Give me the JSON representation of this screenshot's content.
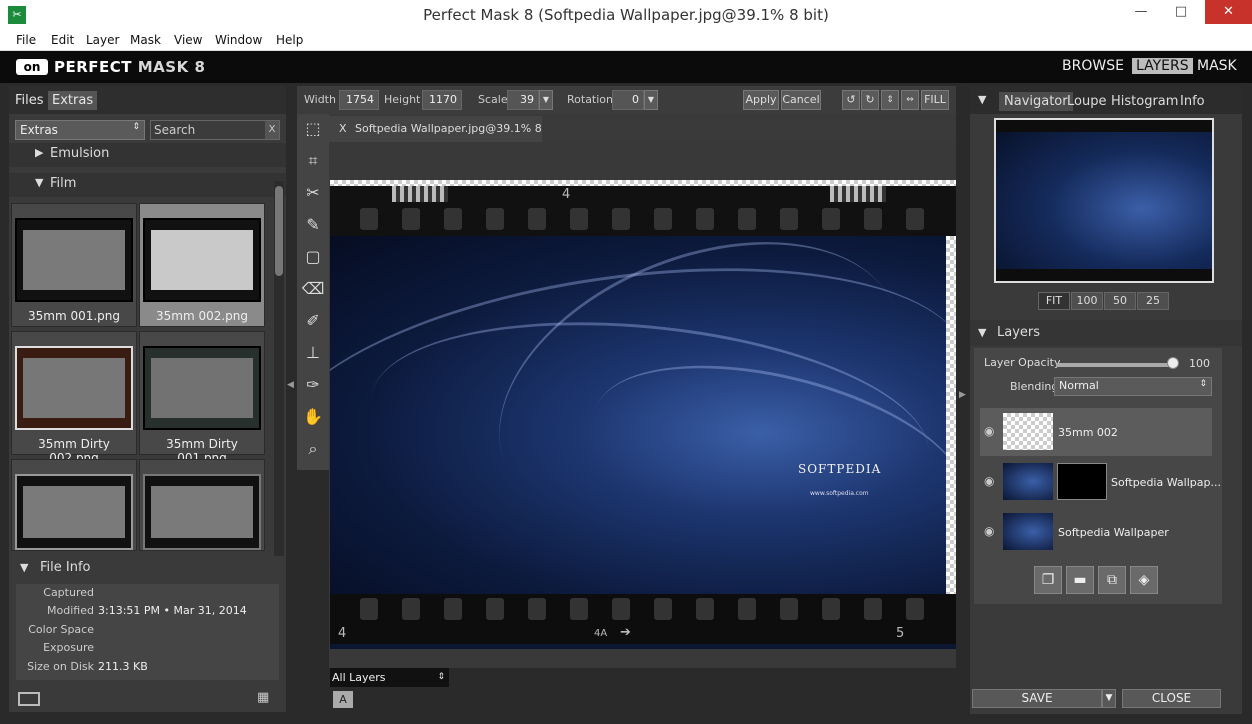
{
  "window": {
    "title": "Perfect Mask 8 (Softpedia Wallpaper.jpg@39.1% 8 bit)",
    "app_icon": "scissors-icon",
    "minimize": "—",
    "maximize": "□",
    "close": "✕"
  },
  "menu": [
    "File",
    "Edit",
    "Layer",
    "Mask",
    "View",
    "Window",
    "Help"
  ],
  "brand": {
    "logo": "on",
    "name_bold": "PERFECT",
    "name_rest": " MASK 8",
    "modes": [
      "BROWSE",
      "LAYERS",
      "MASK"
    ],
    "active_mode": "LAYERS"
  },
  "left": {
    "tabs": [
      "Files",
      "Extras"
    ],
    "active_tab": "Extras",
    "source_dropdown": "Extras",
    "search_placeholder": "Search",
    "search_clear": "X",
    "sections": [
      {
        "label": "Emulsion",
        "arrow": "▶"
      },
      {
        "label": "Film",
        "arrow": "▼"
      }
    ],
    "thumbs": [
      {
        "caption": "35mm 001.png"
      },
      {
        "caption": "35mm 002.png"
      },
      {
        "caption": "35mm Dirty 002.png"
      },
      {
        "caption": "35mm Dirty   001.png"
      },
      {
        "caption": ""
      },
      {
        "caption": ""
      }
    ],
    "file_info": {
      "title": "File Info",
      "rows": [
        {
          "key": "Captured",
          "value": ""
        },
        {
          "key": "Modified",
          "value": "3:13:51 PM • Mar 31, 2014"
        },
        {
          "key": "Color Space",
          "value": ""
        },
        {
          "key": "Exposure",
          "value": ""
        },
        {
          "key": "Size on Disk",
          "value": "211.3 KB"
        }
      ]
    }
  },
  "toolbar": {
    "width_label": "Width",
    "width_value": "1754",
    "height_label": "Height",
    "height_value": "1170",
    "scale_label": "Scale",
    "scale_value": "39",
    "rotation_label": "Rotation",
    "rotation_value": "0",
    "apply": "Apply",
    "cancel": "Cancel",
    "fill": "FILL"
  },
  "document": {
    "tab_close": "X",
    "tab_label": "Softpedia Wallpaper.jpg@39.1% 8 bit",
    "film_numbers": {
      "top": "4",
      "bottom_left": "4",
      "bottom_mid": "4A",
      "bottom_right": "5"
    },
    "watermark": "SOFTPEDIA",
    "url_text": "www.softpedia.com",
    "layer_select": "All Layers",
    "a_button": "A"
  },
  "right": {
    "tabs": [
      "Navigator",
      "Loupe",
      "Histogram",
      "Info"
    ],
    "active_tab": "Navigator",
    "zoom": [
      "FIT",
      "100",
      "50",
      "25"
    ],
    "layers_title": "Layers",
    "opacity_label": "Layer Opacity",
    "opacity_value": "100",
    "opacity_level": 1.0,
    "blending_label": "Blending",
    "blending_value": "Normal",
    "layers": [
      {
        "name": "35mm 002",
        "selected": true
      },
      {
        "name": "Softpedia Wallpap...",
        "selected": false
      },
      {
        "name": "Softpedia Wallpaper",
        "selected": false
      }
    ],
    "save": "SAVE",
    "close": "CLOSE"
  },
  "colors": {
    "accent_close": "#c7322b",
    "panel": "#3a3a3a",
    "wallpaper_blue": "#1d3670"
  }
}
